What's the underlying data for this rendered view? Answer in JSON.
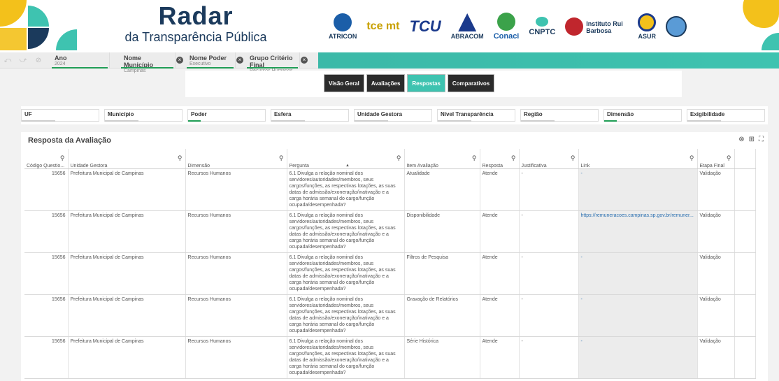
{
  "header": {
    "title": "Radar",
    "subtitle": "da Transparência Pública",
    "logos": [
      {
        "name": "ATRICON",
        "color": "#1b5ea8"
      },
      {
        "name": "tce mt",
        "color": "#c8a000"
      },
      {
        "name": "TCU",
        "color": "#1b3a8c"
      },
      {
        "name": "ABRACOM",
        "color": "#1b3a8c"
      },
      {
        "name": "Conaci",
        "color": "#1b5ea8"
      },
      {
        "name": "CNPTC",
        "color": "#1b3a5c"
      },
      {
        "name": "Instituto Rui Barbosa",
        "color": "#c0262d"
      },
      {
        "name": "ASUR",
        "color": "#1b3a5c"
      }
    ]
  },
  "filters": [
    {
      "label": "Ano",
      "value": "2024"
    },
    {
      "label": "Nome Município",
      "value": "Campinas"
    },
    {
      "label": "Nome Poder",
      "value": "Executivo"
    },
    {
      "label": "Grupo Critério Final",
      "value": "Recursos Humanos"
    }
  ],
  "tabs": [
    "Visão Geral",
    "Avaliações",
    "Respostas",
    "Comparativos"
  ],
  "active_tab": "Respostas",
  "listboxes": [
    "UF",
    "Município",
    "Poder",
    "Esfera",
    "Unidade Gestora",
    "Nível Transparência",
    "Região",
    "Dimensão",
    "Exigibilidade"
  ],
  "panel": {
    "title": "Resposta da Avaliação"
  },
  "columns": [
    "Código Questio...",
    "Unidade Gestora",
    "Dimensão",
    "Pergunta",
    "Item Avaliação",
    "Resposta",
    "Justificativa",
    "Link",
    "Etapa Final"
  ],
  "rows": [
    {
      "codigo": "15656",
      "unidade": "Prefeitura Municipal de Campinas",
      "dimensao": "Recursos Humanos",
      "pergunta": "6.1 Divulga a relação nominal dos servidores/autoridades/membros, seus cargos/funções, as respectivas lotações, as suas datas de admissão/exoneração/inativação e a carga horária semanal do cargo/função ocupada/desempenhada?",
      "item": "Atualidade",
      "resposta": "Atende",
      "justificativa": "-",
      "link": "-",
      "etapa": "Validação"
    },
    {
      "codigo": "15656",
      "unidade": "Prefeitura Municipal de Campinas",
      "dimensao": "Recursos Humanos",
      "pergunta": "6.1 Divulga a relação nominal dos servidores/autoridades/membros, seus cargos/funções, as respectivas lotações, as suas datas de admissão/exoneração/inativação e a carga horária semanal do cargo/função ocupada/desempenhada?",
      "item": "Disponibilidade",
      "resposta": "Atende",
      "justificativa": "-",
      "link": "https://remuneracoes.campinas.sp.gov.br/remuner...",
      "etapa": "Validação"
    },
    {
      "codigo": "15656",
      "unidade": "Prefeitura Municipal de Campinas",
      "dimensao": "Recursos Humanos",
      "pergunta": "6.1 Divulga a relação nominal dos servidores/autoridades/membros, seus cargos/funções, as respectivas lotações, as suas datas de admissão/exoneração/inativação e a carga horária semanal do cargo/função ocupada/desempenhada?",
      "item": "Filtros de Pesquisa",
      "resposta": "Atende",
      "justificativa": "-",
      "link": "-",
      "etapa": "Validação"
    },
    {
      "codigo": "15656",
      "unidade": "Prefeitura Municipal de Campinas",
      "dimensao": "Recursos Humanos",
      "pergunta": "6.1 Divulga a relação nominal dos servidores/autoridades/membros, seus cargos/funções, as respectivas lotações, as suas datas de admissão/exoneração/inativação e a carga horária semanal do cargo/função ocupada/desempenhada?",
      "item": "Gravação de Relatórios",
      "resposta": "Atende",
      "justificativa": "-",
      "link": "-",
      "etapa": "Validação"
    },
    {
      "codigo": "15656",
      "unidade": "Prefeitura Municipal de Campinas",
      "dimensao": "Recursos Humanos",
      "pergunta": "6.1 Divulga a relação nominal dos servidores/autoridades/membros, seus cargos/funções, as respectivas lotações, as suas datas de admissão/exoneração/inativação e a carga horária semanal do cargo/função ocupada/desempenhada?",
      "item": "Série Histórica",
      "resposta": "Atende",
      "justificativa": "-",
      "link": "-",
      "etapa": "Validação"
    }
  ]
}
